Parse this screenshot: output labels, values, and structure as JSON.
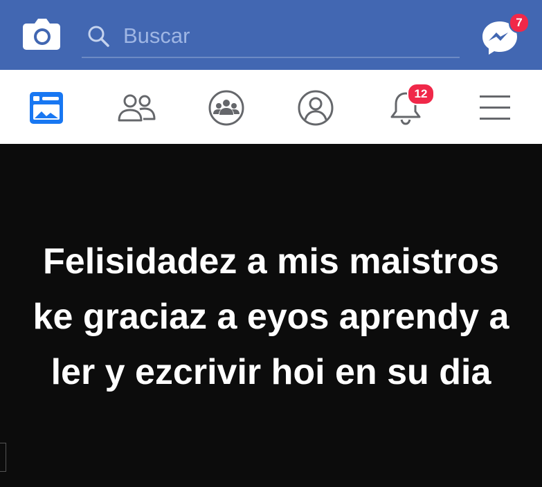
{
  "header": {
    "search_placeholder": "Buscar",
    "messenger_badge": "7",
    "colors": {
      "bar": "#4267b2",
      "badge": "#f02849",
      "search_text": "#9fb6e4"
    },
    "icons": [
      "camera-icon",
      "search-icon",
      "messenger-icon"
    ]
  },
  "nav": {
    "notifications_badge": "12",
    "icons": [
      "news-feed-icon",
      "friends-icon",
      "groups-icon",
      "profile-icon",
      "notifications-bell-icon",
      "menu-icon"
    ],
    "colors": {
      "active": "#1877f2",
      "inactive": "#65676b"
    }
  },
  "post": {
    "text": "Felisidadez a mis maistros ke graciaz a eyos aprendy a ler y ezcrivir hoi en su dia",
    "background": "#0c0c0c"
  }
}
